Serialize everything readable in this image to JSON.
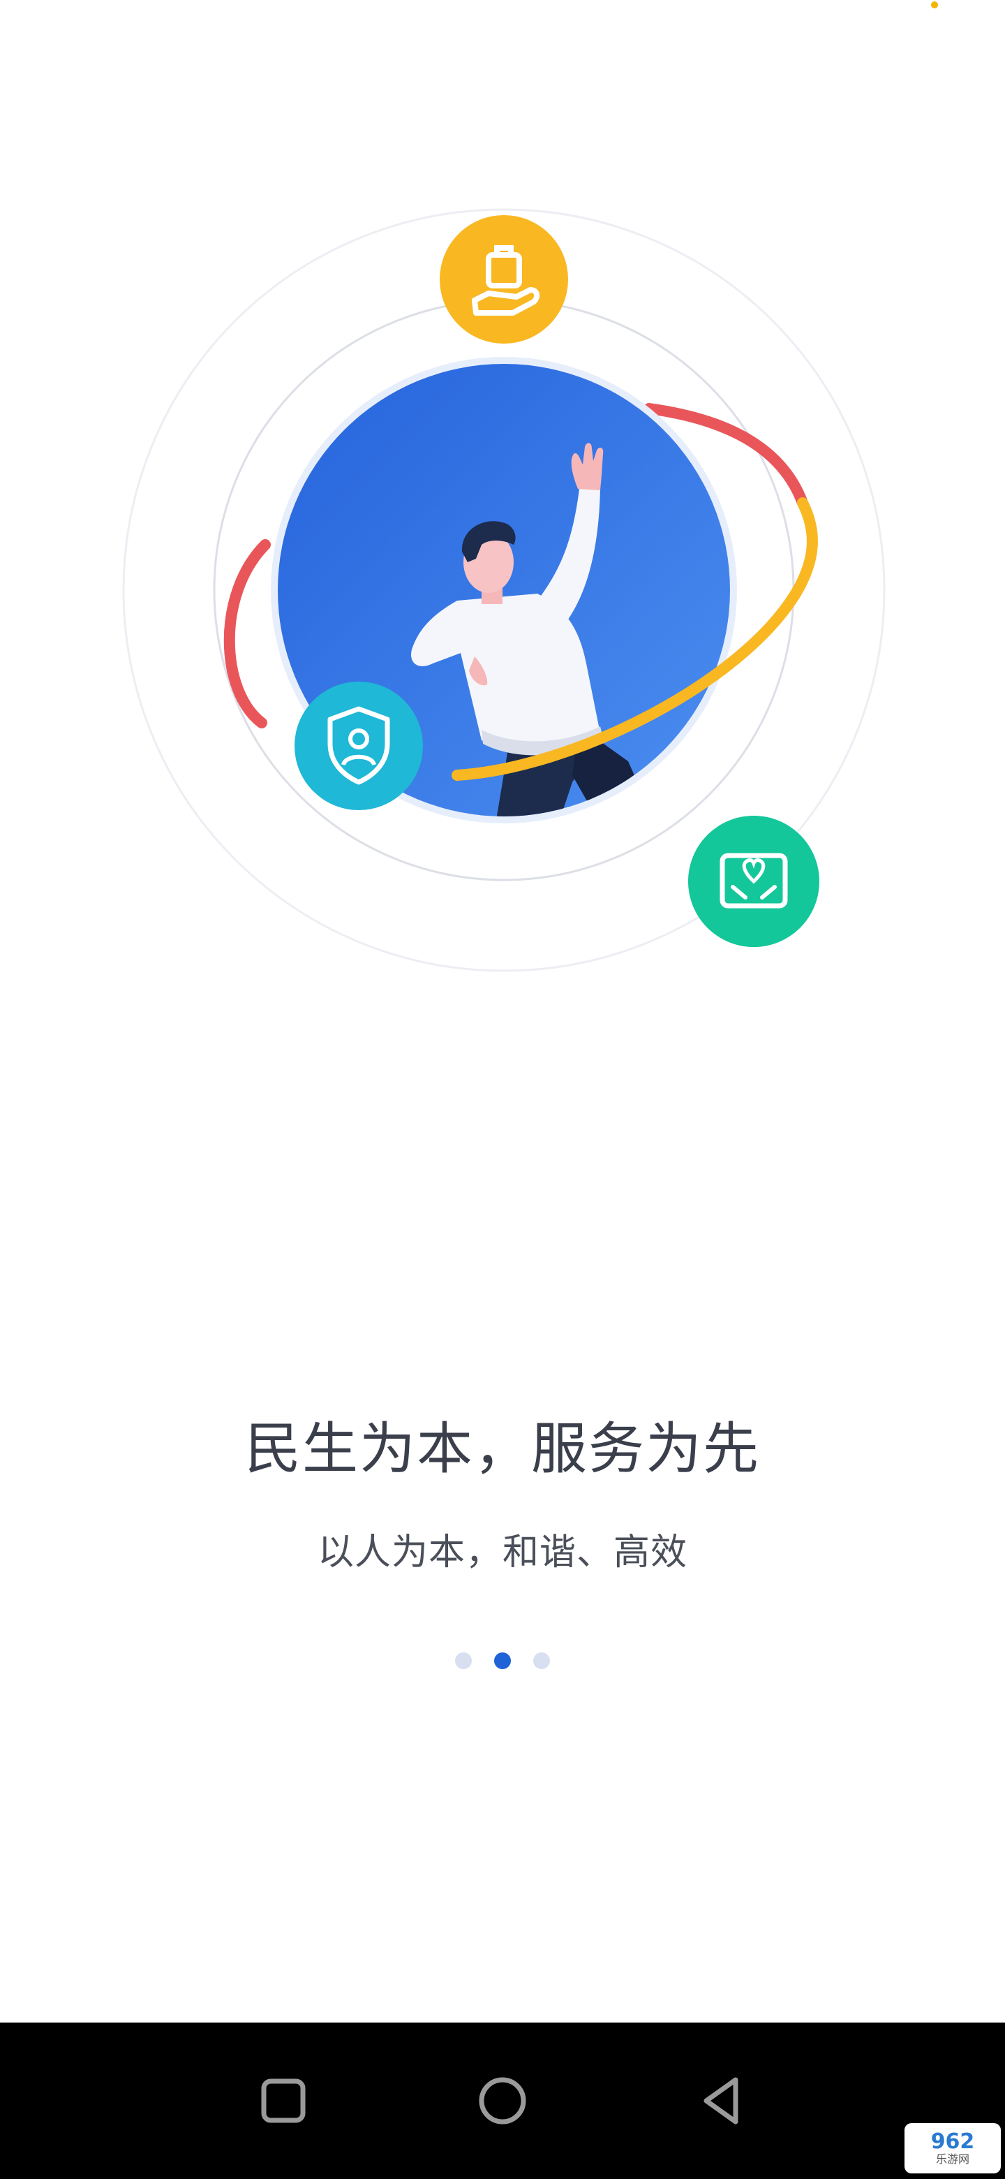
{
  "onboarding": {
    "title": "民生为本，服务为先",
    "subtitle": "以人为本，和谐、高效",
    "page_indicator": {
      "total": 3,
      "current": 2
    }
  },
  "illustration": {
    "icons": [
      "luggage-hand-icon",
      "shield-person-icon",
      "heart-hands-icon"
    ],
    "colors": {
      "blue": "#2a6fe0",
      "yellow": "#f9b722",
      "teal": "#1fb8d6",
      "green": "#14c79a",
      "red": "#e9565a"
    }
  },
  "system_nav": {
    "buttons": [
      "recents-square-icon",
      "home-circle-icon",
      "back-triangle-icon"
    ]
  },
  "watermark": {
    "main": "962",
    "sub": "乐游网"
  }
}
